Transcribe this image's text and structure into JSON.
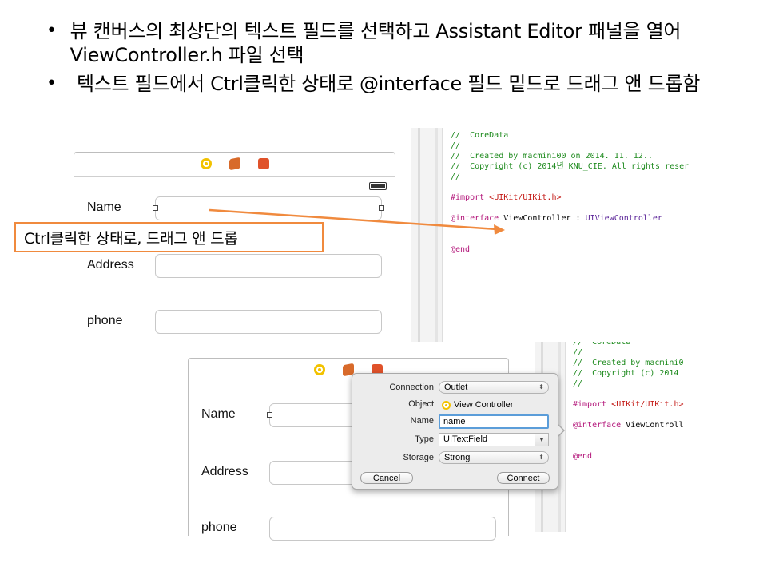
{
  "slide": {
    "bullets": [
      "뷰 캔버스의 최상단의 텍스트 필드를 선택하고 Assistant Editor 패널을 열어 ViewController.h 파일 선택",
      "텍스트 필드에서 Ctrl클릭한 상태로 @interface 필드 밑드로 드래그 앤 드롭함"
    ],
    "callout": "Ctrl클릭한 상태로, 드래그 앤 드롭"
  },
  "scene_top": {
    "fields": [
      {
        "label": "Name"
      },
      {
        "label": "Address"
      },
      {
        "label": "phone"
      }
    ]
  },
  "scene_bottom": {
    "fields": [
      {
        "label": "Name"
      },
      {
        "label": "Address"
      },
      {
        "label": "phone"
      }
    ]
  },
  "editor_top": {
    "lines": [
      {
        "kind": "comment",
        "text": "//  CoreData"
      },
      {
        "kind": "comment",
        "text": "//"
      },
      {
        "kind": "comment",
        "text": "//  Created by macmini00 on 2014. 11. 12.."
      },
      {
        "kind": "comment",
        "text": "//  Copyright (c) 2014년 KNU_CIE. All rights reser"
      },
      {
        "kind": "comment",
        "text": "//"
      },
      {
        "kind": "blank",
        "text": ""
      },
      {
        "kind": "import",
        "kw": "#import",
        "str": " <UIKit/UIKit.h>"
      },
      {
        "kind": "blank",
        "text": ""
      },
      {
        "kind": "interface",
        "kw": "@interface",
        "plain": " ViewController : ",
        "cls": "UIViewController"
      },
      {
        "kind": "blank",
        "text": ""
      },
      {
        "kind": "blank",
        "text": ""
      },
      {
        "kind": "end",
        "kw": "@end"
      }
    ]
  },
  "editor_bottom": {
    "lines": [
      {
        "kind": "comment",
        "text": "//  CoreData"
      },
      {
        "kind": "comment",
        "text": "//"
      },
      {
        "kind": "comment",
        "text": "//  Created by macmini0"
      },
      {
        "kind": "comment",
        "text": "//  Copyright (c) 2014"
      },
      {
        "kind": "comment",
        "text": "//"
      },
      {
        "kind": "blank",
        "text": ""
      },
      {
        "kind": "import",
        "kw": "#import",
        "str": " <UIKit/UIKit.h>"
      },
      {
        "kind": "blank",
        "text": ""
      },
      {
        "kind": "interface",
        "kw": "@interface",
        "plain": " ViewControll",
        "cls": ""
      },
      {
        "kind": "blank",
        "text": ""
      },
      {
        "kind": "blank",
        "text": ""
      },
      {
        "kind": "end",
        "kw": "@end"
      }
    ]
  },
  "popover": {
    "connection_label": "Connection",
    "connection_value": "Outlet",
    "object_label": "Object",
    "object_value": "View Controller",
    "name_label": "Name",
    "name_value": "name",
    "type_label": "Type",
    "type_value": "UITextField",
    "storage_label": "Storage",
    "storage_value": "Strong",
    "cancel_label": "Cancel",
    "connect_label": "Connect"
  },
  "colors": {
    "callout_border": "#f08a3e",
    "drag_line": "#f08a3e",
    "comment": "#1d8a1d",
    "keyword": "#b3167a",
    "string": "#c41a16",
    "class": "#5c2699",
    "focus_ring": "#5b9dd9"
  },
  "icons": [
    "view-controller-icon",
    "first-responder-icon",
    "exit-icon"
  ]
}
